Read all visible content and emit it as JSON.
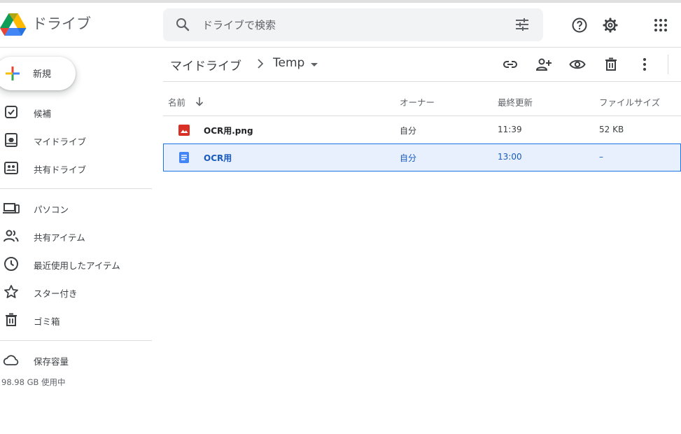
{
  "header": {
    "app_title": "ドライブ",
    "search_placeholder": "ドライブで検索"
  },
  "sidebar": {
    "new_label": "新規",
    "items": [
      {
        "label": "候補",
        "icon": "suggested-icon"
      },
      {
        "label": "マイドライブ",
        "icon": "my-drive-icon"
      },
      {
        "label": "共有ドライブ",
        "icon": "shared-drives-icon"
      },
      {
        "label": "パソコン",
        "icon": "computers-icon"
      },
      {
        "label": "共有アイテム",
        "icon": "shared-with-me-icon"
      },
      {
        "label": "最近使用したアイテム",
        "icon": "recent-icon"
      },
      {
        "label": "スター付き",
        "icon": "star-icon"
      },
      {
        "label": "ゴミ箱",
        "icon": "trash-icon"
      },
      {
        "label": "保存容量",
        "icon": "cloud-icon"
      }
    ],
    "storage_used": "98.98 GB 使用中"
  },
  "breadcrumb": {
    "root": "マイドライブ",
    "current": "Temp"
  },
  "table": {
    "columns": {
      "name": "名前",
      "owner": "オーナー",
      "modified": "最終更新",
      "size": "ファイルサイズ"
    },
    "rows": [
      {
        "name": "OCR用.png",
        "owner": "自分",
        "modified": "11:39",
        "size": "52 KB",
        "type": "image",
        "selected": false
      },
      {
        "name": "OCR用",
        "owner": "自分",
        "modified": "13:00",
        "size": "–",
        "type": "document",
        "selected": true
      }
    ]
  },
  "colors": {
    "accent": "#1a73e8",
    "selected_bg": "#e8f0fe",
    "image_icon": "#d93025",
    "doc_icon": "#4285f4"
  }
}
